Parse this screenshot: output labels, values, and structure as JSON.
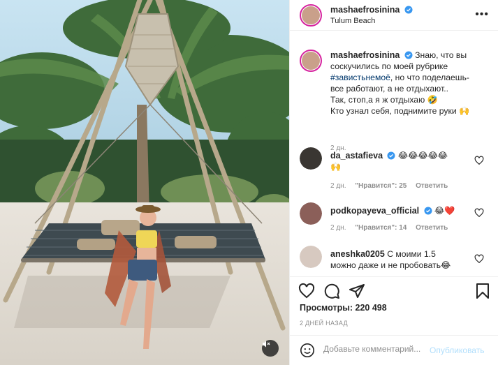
{
  "post": {
    "author": "mashaefrosinina",
    "location": "Tulum Beach",
    "caption_lines": [
      "Знаю, что вы",
      "соскучились по моей рубрике",
      "#завистьнемоё",
      ", но что поделаешь-",
      "все работают, а не отдыхают..",
      "Так, стоп,а я ж отдыхаю 🤣",
      "Кто узнал себя, поднимите руки 🙌"
    ],
    "caption_age": "2 дн."
  },
  "comments": [
    {
      "user": "da_astafieva",
      "text": "😂😂😂😂😂",
      "text2": "🙌",
      "age": "2 дн.",
      "likes": "\"Нравится\": 25",
      "reply": "Ответить"
    },
    {
      "user": "podkopayeva_official",
      "text": "😂❤️",
      "age": "2 дн.",
      "likes": "\"Нравится\": 14",
      "reply": "Ответить"
    },
    {
      "user": "aneshka0205",
      "text": "С моими 1.5",
      "text2": "можно даже и не пробовать😂"
    }
  ],
  "stats": {
    "views_label": "Просмотры:",
    "views_count": "220 498",
    "date": "2 ДНЕЙ НАЗАД"
  },
  "composer": {
    "placeholder": "Добавьте комментарий...",
    "publish": "Опубликовать"
  },
  "icons": {
    "more": "more-horizontal-icon",
    "like": "heart-icon",
    "comment": "comment-icon",
    "share": "share-icon",
    "save": "bookmark-icon",
    "mute": "muted-speaker-icon",
    "emoji": "emoji-icon",
    "verified": "verified-badge-icon"
  },
  "colors": {
    "link": "#00376b",
    "verified": "#3897f0",
    "muted_text": "#8e8e8e",
    "publish_disabled": "#b2dffc"
  }
}
